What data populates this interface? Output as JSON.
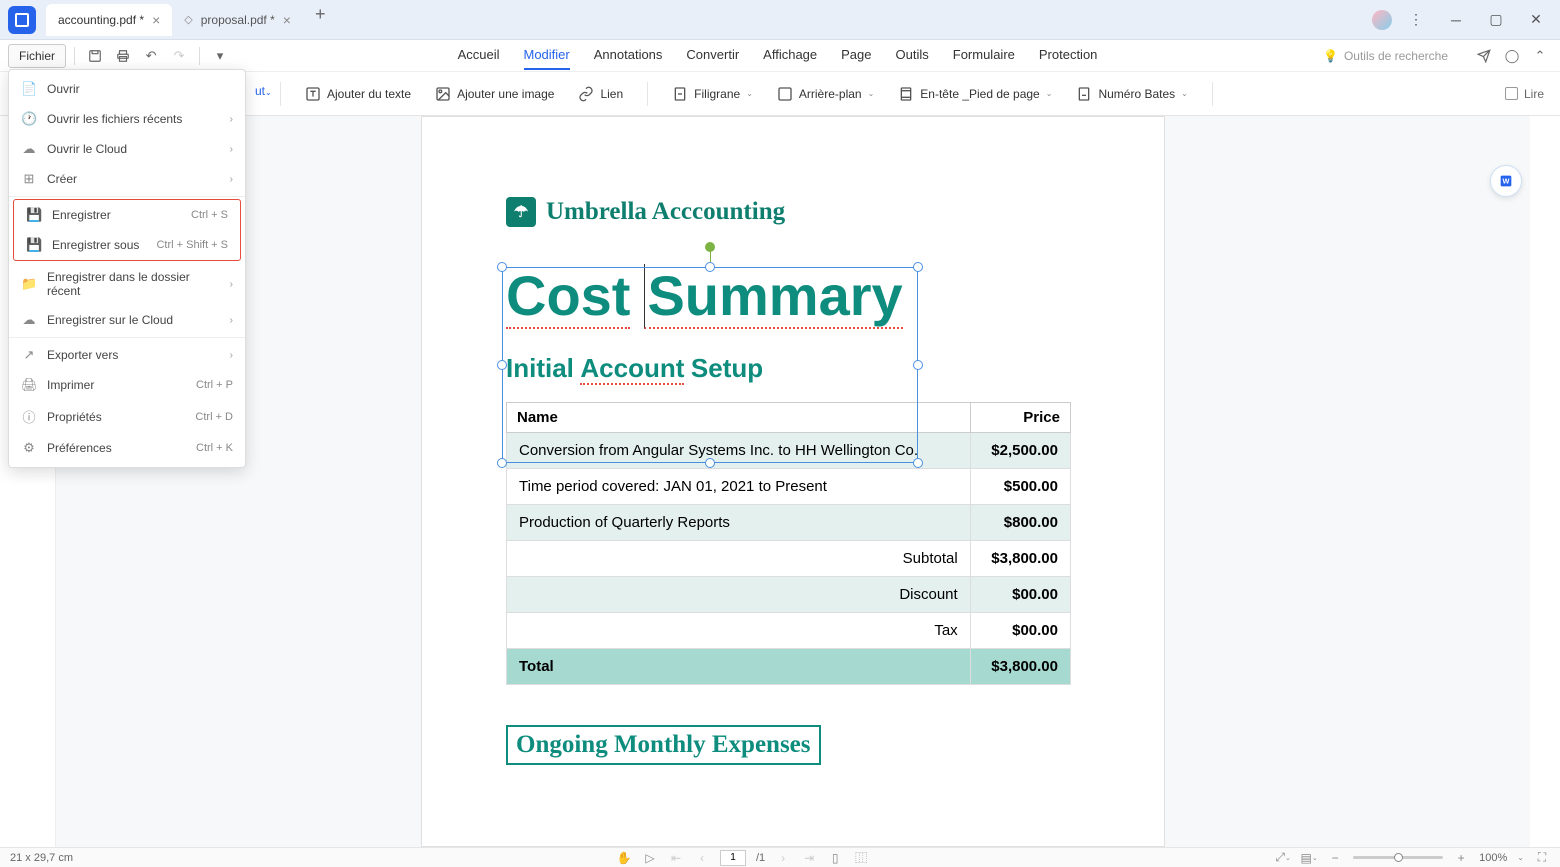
{
  "tabs": [
    {
      "label": "accounting.pdf *",
      "active": true
    },
    {
      "label": "proposal.pdf *",
      "active": false
    }
  ],
  "file_btn": "Fichier",
  "nav": {
    "accueil": "Accueil",
    "modifier": "Modifier",
    "annotations": "Annotations",
    "convertir": "Convertir",
    "affichage": "Affichage",
    "page": "Page",
    "outils": "Outils",
    "formulaire": "Formulaire",
    "protection": "Protection"
  },
  "search_tools": "Outils de recherche",
  "sub": {
    "peek": "ut",
    "add_text": "Ajouter du texte",
    "add_image": "Ajouter une image",
    "link": "Lien",
    "watermark": "Filigrane",
    "background": "Arrière-plan",
    "header_footer": "En-tête _Pied de page",
    "bates": "Numéro Bates",
    "read": "Lire"
  },
  "file_menu": {
    "open": "Ouvrir",
    "open_recent": "Ouvrir les fichiers récents",
    "open_cloud": "Ouvrir le Cloud",
    "create": "Créer",
    "save": "Enregistrer",
    "save_sc": "Ctrl + S",
    "save_as": "Enregistrer sous",
    "save_as_sc": "Ctrl + Shift + S",
    "save_recent_folder": "Enregistrer dans le dossier récent",
    "save_cloud": "Enregistrer sur le Cloud",
    "export": "Exporter vers",
    "print": "Imprimer",
    "print_sc": "Ctrl + P",
    "properties": "Propriétés",
    "properties_sc": "Ctrl + D",
    "preferences": "Préférences",
    "preferences_sc": "Ctrl + K"
  },
  "doc": {
    "logo_text": "Umbrella Acccounting",
    "title_w1": "Cost",
    "title_w2": "Summary",
    "subtitle_w1": "Initial",
    "subtitle_w2": "Account",
    "subtitle_w3": "Setup",
    "col_name": "Name",
    "col_price": "Price",
    "rows": [
      {
        "name": "Conversion from Angular Systems Inc. to HH Wellington Co.",
        "price": "$2,500.00",
        "shade": true
      },
      {
        "name": "Time period covered: JAN 01, 2021 to Present",
        "price": "$500.00",
        "shade": false
      },
      {
        "name": "Production of Quarterly Reports",
        "price": "$800.00",
        "shade": true
      }
    ],
    "subtotal_label": "Subtotal",
    "subtotal_val": "$3,800.00",
    "discount_label": "Discount",
    "discount_val": "$00.00",
    "tax_label": "Tax",
    "tax_val": "$00.00",
    "total_label": "Total",
    "total_val": "$3,800.00",
    "section2": "Ongoing Monthly Expenses"
  },
  "status": {
    "dims": "21 x 29,7 cm",
    "page": "1",
    "total_pages": "/1",
    "zoom": "100%"
  }
}
